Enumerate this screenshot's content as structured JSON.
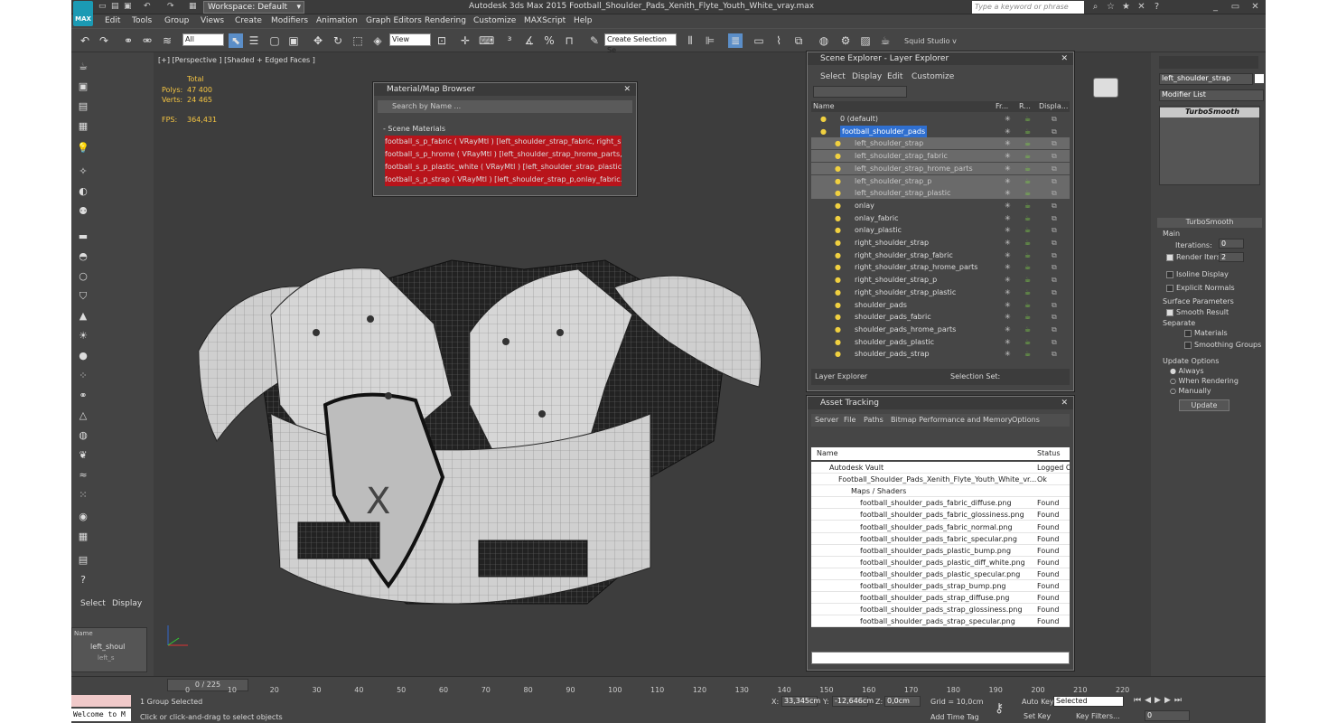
{
  "title_bar": {
    "workspace": "Workspace: Default",
    "window_title": "Autodesk 3ds Max  2015      Football_Shoulder_Pads_Xenith_Flyte_Youth_White_vray.max",
    "search_placeholder": "Type a keyword or phrase",
    "logo": "MAX"
  },
  "menu": [
    "Edit",
    "Tools",
    "Group",
    "Views",
    "Create",
    "Modifiers",
    "Animation",
    "Graph Editors",
    "Rendering",
    "Customize",
    "MAXScript",
    "Help"
  ],
  "toolbar": {
    "filter": "All",
    "refcoord": "View",
    "selection_set": "Create Selection Se",
    "squid": "Squid Studio v"
  },
  "viewport": {
    "label": "[+] [Perspective ] [Shaded + Edged Faces ]",
    "stats_total": "Total",
    "polys_label": "Polys:",
    "polys": "47 400",
    "verts_label": "Verts:",
    "verts": "24 465",
    "fps_label": "FPS:",
    "fps": "364,431"
  },
  "material_browser": {
    "title": "Material/Map Browser",
    "search": "Search by Name ...",
    "section": "- Scene Materials",
    "items": [
      "football_s_p_fabric ( VRayMtl ) [left_shoulder_strap_fabric, right_s...",
      "football_s_p_hrome ( VRayMtl ) [left_shoulder_strap_hrome_parts,...",
      "football_s_p_plastic_white ( VRayMtl ) [left_shoulder_strap_plastic...",
      "football_s_p_strap ( VRayMtl ) [left_shoulder_strap_p,onlay_fabric..."
    ]
  },
  "scene_explorer": {
    "title": "Scene Explorer - Layer Explorer",
    "menus": [
      "Select",
      "Display",
      "Edit",
      "Customize"
    ],
    "col_name": "Name",
    "col_fr": "Fr...",
    "col_r": "R...",
    "col_disp": "Displa...",
    "layer_default": "0 (default)",
    "layer_main": "football_shoulder_pads",
    "objects": [
      "left_shoulder_strap",
      "left_shoulder_strap_fabric",
      "left_shoulder_strap_hrome_parts",
      "left_shoulder_strap_p",
      "left_shoulder_strap_plastic",
      "onlay",
      "onlay_fabric",
      "onlay_plastic",
      "right_shoulder_strap",
      "right_shoulder_strap_fabric",
      "right_shoulder_strap_hrome_parts",
      "right_shoulder_strap_p",
      "right_shoulder_strap_plastic",
      "shoulder_pads",
      "shoulder_pads_fabric",
      "shoulder_pads_hrome_parts",
      "shoulder_pads_plastic",
      "shoulder_pads_strap"
    ],
    "footer_explorer": "Layer Explorer",
    "footer_selset": "Selection Set:"
  },
  "asset_tracking": {
    "title": "Asset Tracking",
    "menus": [
      "Server",
      "File",
      "Paths",
      "Bitmap Performance and Memory",
      "Options"
    ],
    "col_name": "Name",
    "col_status": "Status",
    "vault": "Autodesk Vault",
    "vault_status": "Logged O",
    "file": "Football_Shoulder_Pads_Xenith_Flyte_Youth_White_vr...",
    "file_status": "Ok",
    "maps": "Maps / Shaders",
    "files": [
      "football_shoulder_pads_fabric_diffuse.png",
      "football_shoulder_pads_fabric_glossiness.png",
      "football_shoulder_pads_fabric_normal.png",
      "football_shoulder_pads_fabric_specular.png",
      "football_shoulder_pads_plastic_bump.png",
      "football_shoulder_pads_plastic_diff_white.png",
      "football_shoulder_pads_plastic_specular.png",
      "football_shoulder_pads_strap_bump.png",
      "football_shoulder_pads_strap_diffuse.png",
      "football_shoulder_pads_strap_glossiness.png",
      "football_shoulder_pads_strap_specular.png"
    ],
    "found": "Found"
  },
  "command_panel": {
    "object_name": "left_shoulder_strap",
    "modifier_list": "Modifier List",
    "stack_item": "TurboSmooth",
    "rollout": "TurboSmooth",
    "main": "Main",
    "iterations_label": "Iterations:",
    "iterations": "0",
    "render_iters_label": "Render Iters:",
    "render_iters": "2",
    "isoline": "Isoline Display",
    "explicit": "Explicit Normals",
    "surface": "Surface Parameters",
    "smooth": "Smooth Result",
    "separate": "Separate",
    "materials": "Materials",
    "groups": "Smoothing Groups",
    "update_options": "Update Options",
    "always": "Always",
    "when_rendering": "When Rendering",
    "manually": "Manually",
    "update": "Update"
  },
  "left_cmd": {
    "select": "Select",
    "display": "Display",
    "name_col": "Name",
    "item": "left_shoul",
    "subitem": "left_s"
  },
  "timeline": {
    "frame": "0 / 225",
    "ticks": [
      "0",
      "10",
      "20",
      "30",
      "40",
      "50",
      "60",
      "70",
      "80",
      "90",
      "100",
      "110",
      "120",
      "130",
      "140",
      "150",
      "160",
      "170",
      "180",
      "190",
      "200",
      "210",
      "220"
    ]
  },
  "status": {
    "listener": "Welcome to M",
    "selected": "1 Group Selected",
    "prompt": "Click or click-and-drag to select objects",
    "x_label": "X:",
    "x": "33,345cm",
    "y_label": "Y:",
    "y": "-12,646cm",
    "z_label": "Z:",
    "z": "0,0cm",
    "grid": "Grid = 10,0cm",
    "autokey": "Auto Key",
    "selected_mode": "Selected",
    "setkey": "Set Key",
    "keyfilters": "Key Filters...",
    "add_time_tag": "Add Time Tag",
    "frame_field": "0"
  }
}
